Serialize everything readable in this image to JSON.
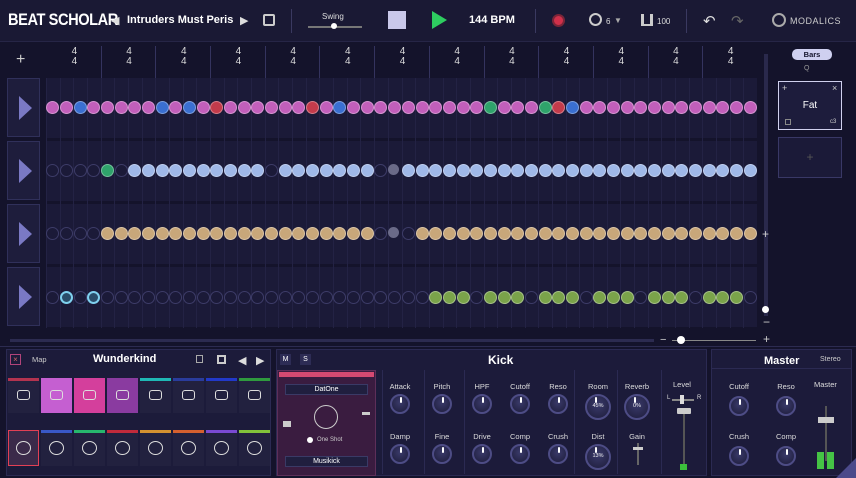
{
  "header": {
    "logo": "BEAT SCHOLAR",
    "song": "Intruders Must Peris",
    "swing_label": "Swing",
    "bpm": "144 BPM",
    "count": "6",
    "volume": "100",
    "brand": "MODALICS"
  },
  "timeline": {
    "bars": [
      "4/4",
      "4/4",
      "4/4",
      "4/4",
      "4/4",
      "4/4",
      "4/4",
      "4/4",
      "4/4",
      "4/4",
      "4/4",
      "4/4",
      "4/4"
    ],
    "bars_button": "Bars",
    "zoom": "Q"
  },
  "sidepanel": {
    "pattern_name": "Fat",
    "sub": "c3"
  },
  "kit": {
    "map": "Map",
    "name": "Wunderkind"
  },
  "kick": {
    "tab_m": "M",
    "tab_s": "S",
    "title": "Kick",
    "sample1": "DatOne",
    "oneshot": "One Shot",
    "sample2": "Musikick",
    "knobs": [
      "Attack",
      "Pitch",
      "HPF",
      "Cutoff",
      "Reso",
      "Room",
      "Reverb",
      "Damp",
      "Fine",
      "Drive",
      "Comp",
      "Crush",
      "Dist",
      "Gain"
    ],
    "room_val": "45%",
    "reverb_val": "0%",
    "dist_val": "13%",
    "level": "Level",
    "l": "L",
    "r": "R"
  },
  "master": {
    "title": "Master",
    "stereo": "Stereo",
    "labels": [
      "Cutoff",
      "Reso",
      "Crush",
      "Comp"
    ],
    "master_label": "Master"
  },
  "colors": {
    "pink": "#c25fbb",
    "blue": "#3a6fd1",
    "red": "#c33b4b",
    "green": "#2fa36b",
    "olive": "#6f9e45",
    "tan": "#c8a77a",
    "lightblue": "#9fb8e8",
    "lime": "#7aa34a"
  }
}
